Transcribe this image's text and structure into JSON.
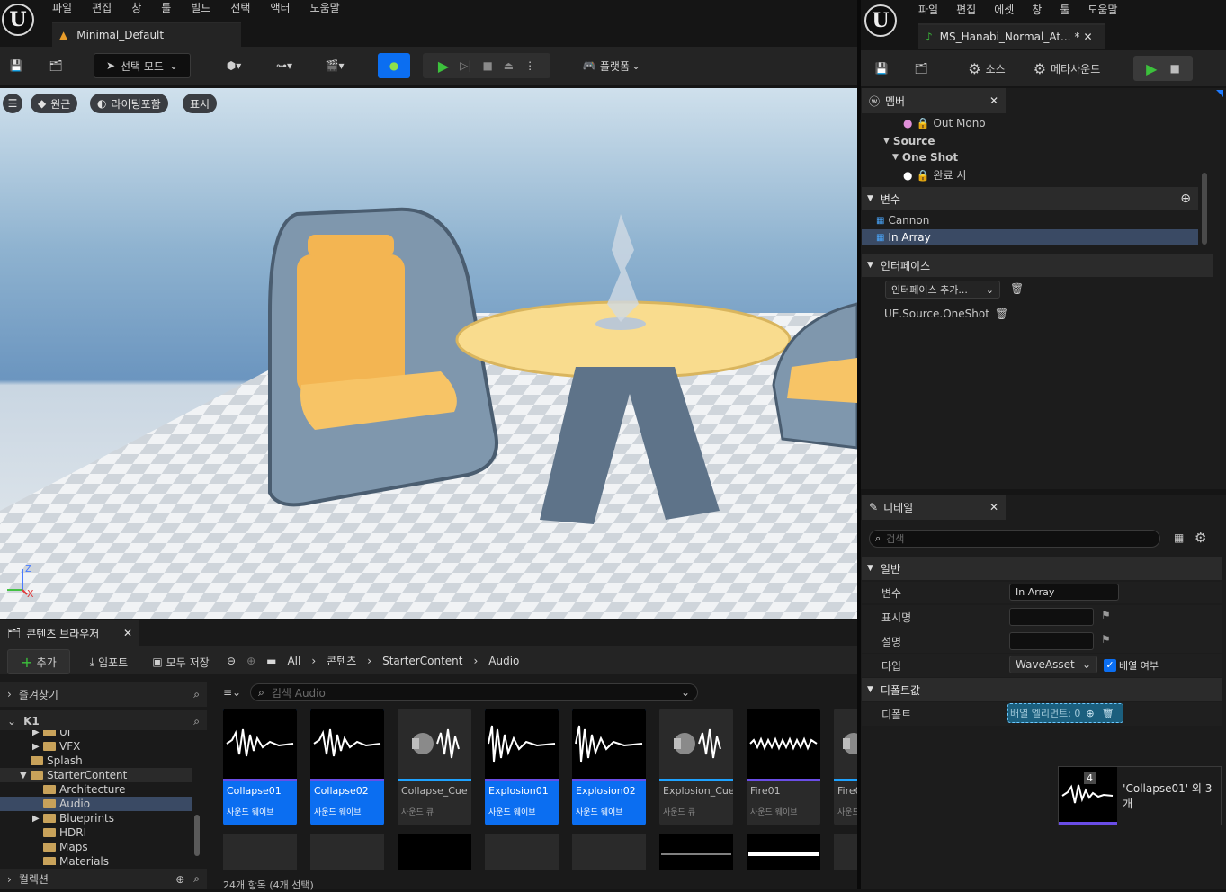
{
  "main_window": {
    "menu": [
      "파일",
      "편집",
      "창",
      "툴",
      "빌드",
      "선택",
      "액터",
      "도움말"
    ],
    "tab_title": "Minimal_Default",
    "toolbar": {
      "select_mode": "선택 모드",
      "platform": "플랫폼"
    },
    "viewport": {
      "perspective": "원근",
      "lighting": "라이팅포함",
      "show": "표시",
      "axis_z": "Z",
      "axis_x": "X"
    }
  },
  "content_browser": {
    "tab_title": "콘텐츠 브라우저",
    "add": "추가",
    "import": "임포트",
    "save_all": "모두 저장",
    "breadcrumb": [
      "All",
      "콘텐츠",
      "StarterContent",
      "Audio"
    ],
    "favorites": "즐겨찾기",
    "project": "K1",
    "collections": "컬렉션",
    "search_placeholder": "검색 Audio",
    "tree": [
      {
        "label": "UI",
        "indent": 1,
        "arrow": true
      },
      {
        "label": "VFX",
        "indent": 1,
        "arrow": true
      },
      {
        "label": "Splash",
        "indent": 0,
        "arrow": false
      },
      {
        "label": "StarterContent",
        "indent": 0,
        "arrow": true,
        "open": true
      },
      {
        "label": "Architecture",
        "indent": 1,
        "arrow": false
      },
      {
        "label": "Audio",
        "indent": 1,
        "arrow": false,
        "selected": true
      },
      {
        "label": "Blueprints",
        "indent": 1,
        "arrow": true
      },
      {
        "label": "HDRI",
        "indent": 1,
        "arrow": false
      },
      {
        "label": "Maps",
        "indent": 1,
        "arrow": false
      },
      {
        "label": "Materials",
        "indent": 1,
        "arrow": false
      }
    ],
    "assets": [
      {
        "name": "Collapse01",
        "type": "사운드 웨이브",
        "selected": true,
        "kind": "wave"
      },
      {
        "name": "Collapse02",
        "type": "사운드 웨이브",
        "selected": true,
        "kind": "wave"
      },
      {
        "name": "Collapse_Cue",
        "type": "사운드 큐",
        "selected": false,
        "kind": "cue"
      },
      {
        "name": "Explosion01",
        "type": "사운드 웨이브",
        "selected": true,
        "kind": "decay"
      },
      {
        "name": "Explosion02",
        "type": "사운드 웨이브",
        "selected": true,
        "kind": "decay"
      },
      {
        "name": "Explosion_Cue",
        "type": "사운드 큐",
        "selected": false,
        "kind": "cue"
      },
      {
        "name": "Fire01",
        "type": "사운드 웨이브",
        "selected": false,
        "kind": "flat"
      },
      {
        "name": "Fire0",
        "type": "사운드",
        "selected": false,
        "kind": "cue"
      }
    ],
    "status": "24개 항목 (4개 선택)"
  },
  "metasound_window": {
    "menu": [
      "파일",
      "편집",
      "에셋",
      "창",
      "툴",
      "도움말"
    ],
    "tab_title": "MS_Hanabi_Normal_At...",
    "tab_modified": "*",
    "toolbar": {
      "source": "소스",
      "metasound": "메타사운드"
    },
    "members": {
      "tab_title": "멤버",
      "out_mono": "Out Mono",
      "source": "Source",
      "one_shot": "One Shot",
      "on_finished": "완료 시",
      "variables_header": "변수",
      "variables": [
        "Cannon",
        "In Array"
      ],
      "interfaces_header": "인터페이스",
      "add_interface": "인터페이스 추가...",
      "interface_item": "UE.Source.OneShot"
    },
    "details": {
      "tab_title": "디테일",
      "search_placeholder": "검색",
      "general_header": "일반",
      "var_label": "변수",
      "var_value": "In Array",
      "display_name_label": "표시명",
      "description_label": "설명",
      "type_label": "타입",
      "type_value": "WaveAsset",
      "is_array_label": "배열 여부",
      "default_header": "디폴트값",
      "default_label": "디폴트",
      "array_elements": "배열 엘리먼트: 0"
    }
  },
  "drag_tooltip": {
    "count": "4",
    "text": "'Collapse01' 외 3개"
  }
}
